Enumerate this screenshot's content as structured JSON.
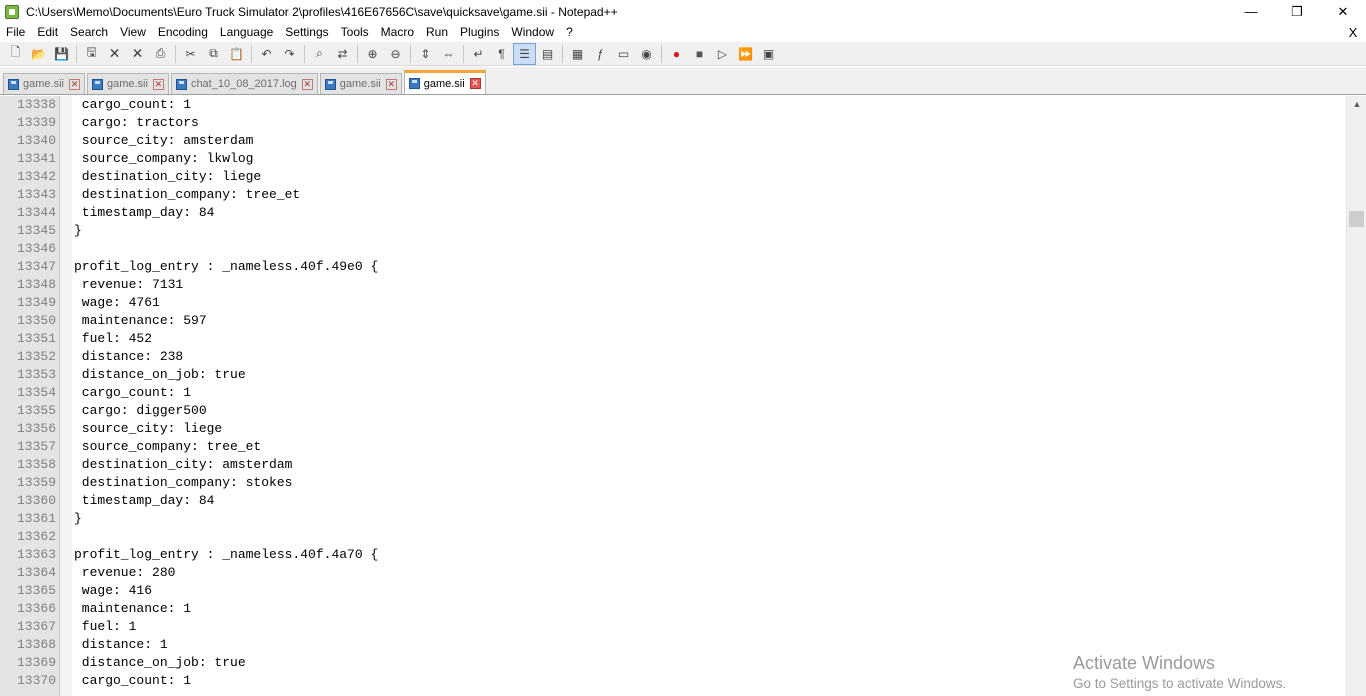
{
  "window": {
    "title": "C:\\Users\\Memo\\Documents\\Euro Truck Simulator 2\\profiles\\416E67656C\\save\\quicksave\\game.sii - Notepad++",
    "minimize": "—",
    "maximize": "❐",
    "close": "✕"
  },
  "menu": {
    "items": [
      "File",
      "Edit",
      "Search",
      "View",
      "Encoding",
      "Language",
      "Settings",
      "Tools",
      "Macro",
      "Run",
      "Plugins",
      "Window",
      "?"
    ],
    "close": "X"
  },
  "toolbar": {
    "icons": [
      "new-file-icon",
      "open-file-icon",
      "save-icon",
      "save-all-icon",
      "close-icon",
      "close-all-icon",
      "print-icon",
      "cut-icon",
      "copy-icon",
      "paste-icon",
      "undo-icon",
      "redo-icon",
      "find-icon",
      "replace-icon",
      "zoom-in-icon",
      "zoom-out-icon",
      "sync-vertical-icon",
      "sync-horizontal-icon",
      "word-wrap-icon",
      "show-all-chars-icon",
      "indent-guide-icon",
      "user-lang-icon",
      "doc-map-icon",
      "function-list-icon",
      "folder-workspace-icon",
      "monitoring-icon",
      "record-macro-icon",
      "stop-record-icon",
      "play-macro-icon",
      "run-macro-multiple-icon",
      "save-macro-icon"
    ]
  },
  "tabs": [
    {
      "label": "game.sii",
      "active": false
    },
    {
      "label": "game.sii",
      "active": false
    },
    {
      "label": "chat_10_08_2017.log",
      "active": false
    },
    {
      "label": "game.sii",
      "active": false
    },
    {
      "label": "game.sii",
      "active": true
    }
  ],
  "editor": {
    "lines": [
      {
        "n": "13338",
        "t": " cargo_count: 1"
      },
      {
        "n": "13339",
        "t": " cargo: tractors"
      },
      {
        "n": "13340",
        "t": " source_city: amsterdam"
      },
      {
        "n": "13341",
        "t": " source_company: lkwlog"
      },
      {
        "n": "13342",
        "t": " destination_city: liege"
      },
      {
        "n": "13343",
        "t": " destination_company: tree_et"
      },
      {
        "n": "13344",
        "t": " timestamp_day: 84"
      },
      {
        "n": "13345",
        "t": "}"
      },
      {
        "n": "13346",
        "t": ""
      },
      {
        "n": "13347",
        "t": "profit_log_entry : _nameless.40f.49e0 {"
      },
      {
        "n": "13348",
        "t": " revenue: 7131"
      },
      {
        "n": "13349",
        "t": " wage: 4761"
      },
      {
        "n": "13350",
        "t": " maintenance: 597"
      },
      {
        "n": "13351",
        "t": " fuel: 452"
      },
      {
        "n": "13352",
        "t": " distance: 238"
      },
      {
        "n": "13353",
        "t": " distance_on_job: true"
      },
      {
        "n": "13354",
        "t": " cargo_count: 1"
      },
      {
        "n": "13355",
        "t": " cargo: digger500"
      },
      {
        "n": "13356",
        "t": " source_city: liege"
      },
      {
        "n": "13357",
        "t": " source_company: tree_et"
      },
      {
        "n": "13358",
        "t": " destination_city: amsterdam"
      },
      {
        "n": "13359",
        "t": " destination_company: stokes"
      },
      {
        "n": "13360",
        "t": " timestamp_day: 84"
      },
      {
        "n": "13361",
        "t": "}"
      },
      {
        "n": "13362",
        "t": ""
      },
      {
        "n": "13363",
        "t": "profit_log_entry : _nameless.40f.4a70 {"
      },
      {
        "n": "13364",
        "t": " revenue: 280"
      },
      {
        "n": "13365",
        "t": " wage: 416"
      },
      {
        "n": "13366",
        "t": " maintenance: 1"
      },
      {
        "n": "13367",
        "t": " fuel: 1"
      },
      {
        "n": "13368",
        "t": " distance: 1"
      },
      {
        "n": "13369",
        "t": " distance_on_job: true"
      },
      {
        "n": "13370",
        "t": " cargo_count: 1"
      }
    ]
  },
  "watermark": {
    "title": "Activate Windows",
    "subtitle": "Go to Settings to activate Windows."
  }
}
